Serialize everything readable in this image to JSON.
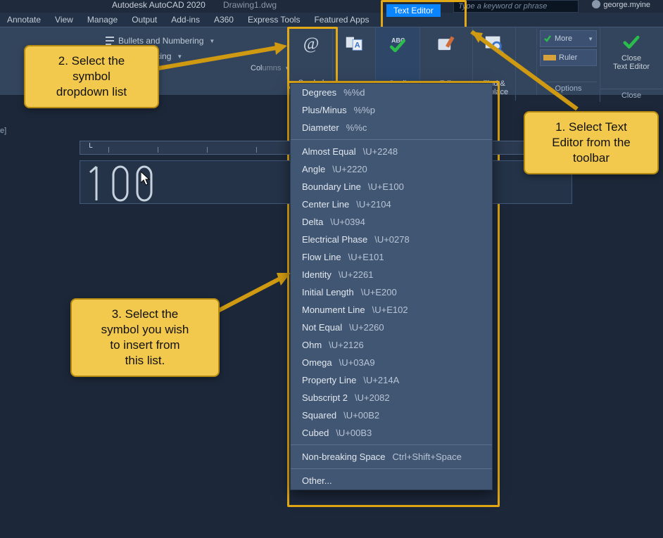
{
  "app": {
    "title": "Autodesk AutoCAD 2020",
    "file": "Drawing1.dwg"
  },
  "search": {
    "placeholder": "Type a keyword or phrase"
  },
  "user": {
    "name": "george.myine"
  },
  "menubar": [
    "Annotate",
    "View",
    "Manage",
    "Output",
    "Add-ins",
    "A360",
    "Express Tools",
    "Featured Apps"
  ],
  "ctx_tab": "Text Editor",
  "ribbon_left": {
    "bullets": "Bullets and Numbering",
    "spacing": "Line Spacing"
  },
  "ribbon_btns": {
    "symbol": "Symbol",
    "field": "Field",
    "spell": "Spell\nCheck",
    "dict": "Edit\nDictionaries",
    "find": "Find &\nReplace"
  },
  "options_panel": {
    "more": "More",
    "ruler": "Ruler",
    "name": "Options"
  },
  "close_panel": {
    "btn": "Close\nText Editor",
    "name": "Close"
  },
  "leftbar": "e]",
  "mtext": "100",
  "symmenu": {
    "top": [
      {
        "label": "Degrees",
        "code": "%%d"
      },
      {
        "label": "Plus/Minus",
        "code": "%%p"
      },
      {
        "label": "Diameter",
        "code": "%%c"
      }
    ],
    "mid": [
      {
        "label": "Almost Equal",
        "code": "\\U+2248"
      },
      {
        "label": "Angle",
        "code": "\\U+2220"
      },
      {
        "label": "Boundary Line",
        "code": "\\U+E100"
      },
      {
        "label": "Center Line",
        "code": "\\U+2104"
      },
      {
        "label": "Delta",
        "code": "\\U+0394"
      },
      {
        "label": "Electrical Phase",
        "code": "\\U+0278"
      },
      {
        "label": "Flow Line",
        "code": "\\U+E101"
      },
      {
        "label": "Identity",
        "code": "\\U+2261"
      },
      {
        "label": "Initial Length",
        "code": "\\U+E200"
      },
      {
        "label": "Monument Line",
        "code": "\\U+E102"
      },
      {
        "label": "Not Equal",
        "code": "\\U+2260"
      },
      {
        "label": "Ohm",
        "code": "\\U+2126"
      },
      {
        "label": "Omega",
        "code": "\\U+03A9"
      },
      {
        "label": "Property Line",
        "code": "\\U+214A"
      },
      {
        "label": "Subscript 2",
        "code": "\\U+2082"
      },
      {
        "label": "Squared",
        "code": "\\U+00B2"
      },
      {
        "label": "Cubed",
        "code": "\\U+00B3"
      }
    ],
    "bottom": [
      {
        "label": "Non-breaking Space",
        "code": "Ctrl+Shift+Space"
      },
      {
        "label": "Other...",
        "code": ""
      }
    ]
  },
  "callouts": {
    "c1": "1. Select Text\nEditor from the\ntoolbar",
    "c2": "2. Select the\nsymbol\ndropdown list",
    "c3": "3. Select the\nsymbol you wish\nto insert from\nthis list."
  }
}
